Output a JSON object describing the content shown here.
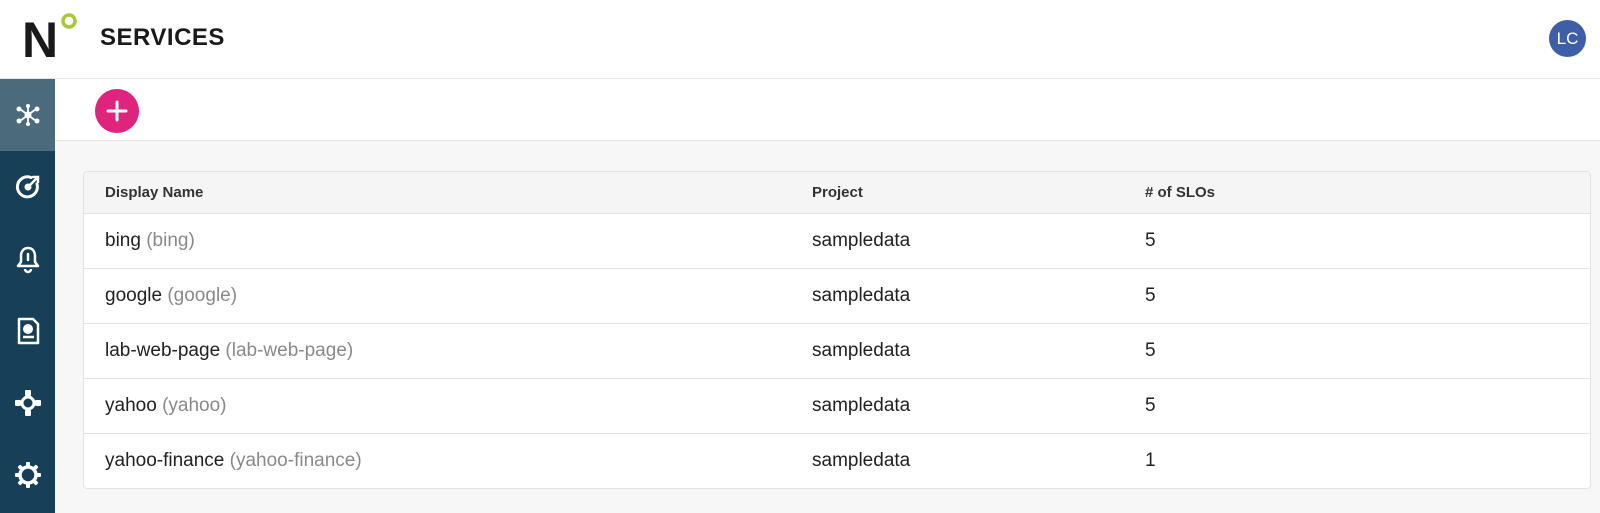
{
  "header": {
    "title": "SERVICES",
    "avatar_initials": "LC"
  },
  "brand": {
    "logo_letter": "N",
    "accent_color": "#a6c839"
  },
  "sidebar": {
    "background": "#173f57",
    "items": [
      {
        "icon": "services-network-icon",
        "active": true
      },
      {
        "icon": "slo-target-icon",
        "active": false
      },
      {
        "icon": "alert-bell-icon",
        "active": false
      },
      {
        "icon": "reports-icon",
        "active": false
      },
      {
        "icon": "integrations-icon",
        "active": false
      },
      {
        "icon": "settings-gear-icon",
        "active": false
      }
    ]
  },
  "toolbar": {
    "add_button_icon": "plus-icon",
    "add_button_color": "#e0247e"
  },
  "table": {
    "columns": [
      "Display Name",
      "Project",
      "# of SLOs"
    ],
    "rows": [
      {
        "display_name": "bing",
        "name": "(bing)",
        "project": "sampledata",
        "slos": "5"
      },
      {
        "display_name": "google",
        "name": "(google)",
        "project": "sampledata",
        "slos": "5"
      },
      {
        "display_name": "lab-web-page",
        "name": "(lab-web-page)",
        "project": "sampledata",
        "slos": "5"
      },
      {
        "display_name": "yahoo",
        "name": "(yahoo)",
        "project": "sampledata",
        "slos": "5"
      },
      {
        "display_name": "yahoo-finance",
        "name": "(yahoo-finance)",
        "project": "sampledata",
        "slos": "1"
      }
    ]
  }
}
